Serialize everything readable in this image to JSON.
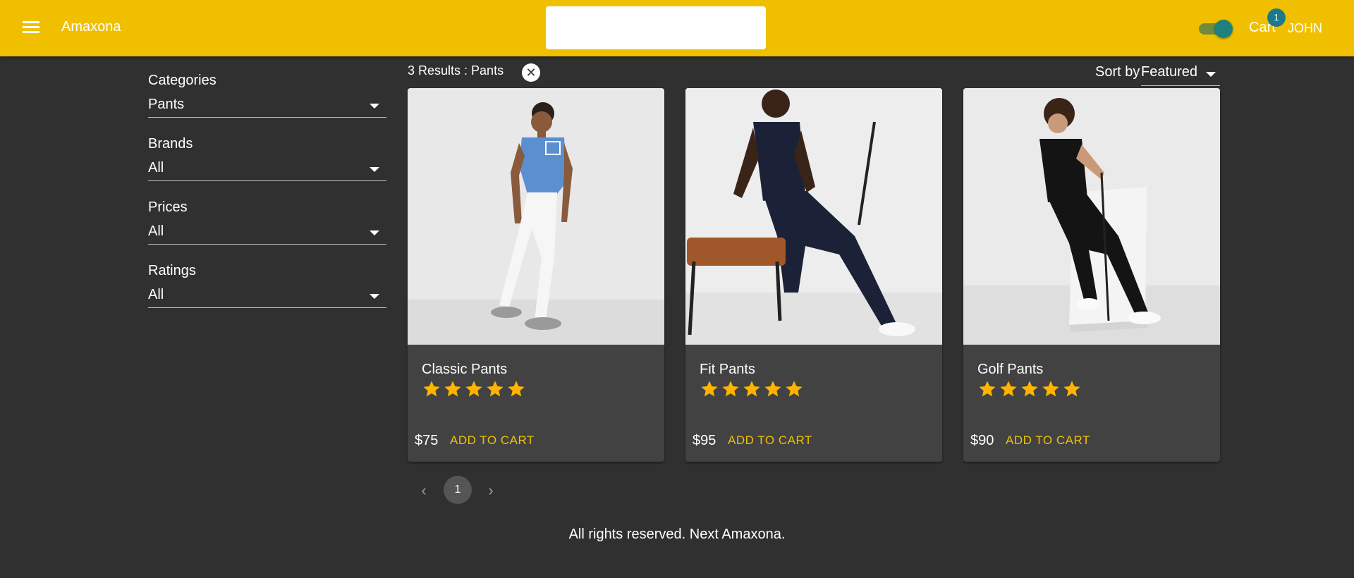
{
  "header": {
    "brand": "Amaxona",
    "search": {
      "value": "",
      "placeholder": ""
    },
    "cart_label": "Cart",
    "cart_count": "1",
    "user_name": "JOHN",
    "dark_mode_on": true,
    "colors": {
      "appbar": "#f0c000",
      "toggle_thumb": "#208080",
      "badge": "#1d7a8a"
    }
  },
  "sidebar": {
    "filters": [
      {
        "label": "Categories",
        "value": "Pants"
      },
      {
        "label": "Brands",
        "value": "All"
      },
      {
        "label": "Prices",
        "value": "All"
      },
      {
        "label": "Ratings",
        "value": "All"
      }
    ]
  },
  "results": {
    "summary": "3 Results : Pants",
    "clear_icon": "close-icon",
    "sort_label": "Sort by",
    "sort_value": "Featured"
  },
  "products": [
    {
      "name": "Classic Pants",
      "rating": 5,
      "price": "$75",
      "action": "ADD TO CART"
    },
    {
      "name": "Fit Pants",
      "rating": 5,
      "price": "$95",
      "action": "ADD TO CART"
    },
    {
      "name": "Golf Pants",
      "rating": 5,
      "price": "$90",
      "action": "ADD TO CART"
    }
  ],
  "pagination": {
    "current": "1",
    "prev_icon": "chevron-left-icon",
    "next_icon": "chevron-right-icon"
  },
  "footer": {
    "text": "All rights reserved. Next Amaxona."
  },
  "accent_color": "#f0c000",
  "star_color": "#ffb400"
}
